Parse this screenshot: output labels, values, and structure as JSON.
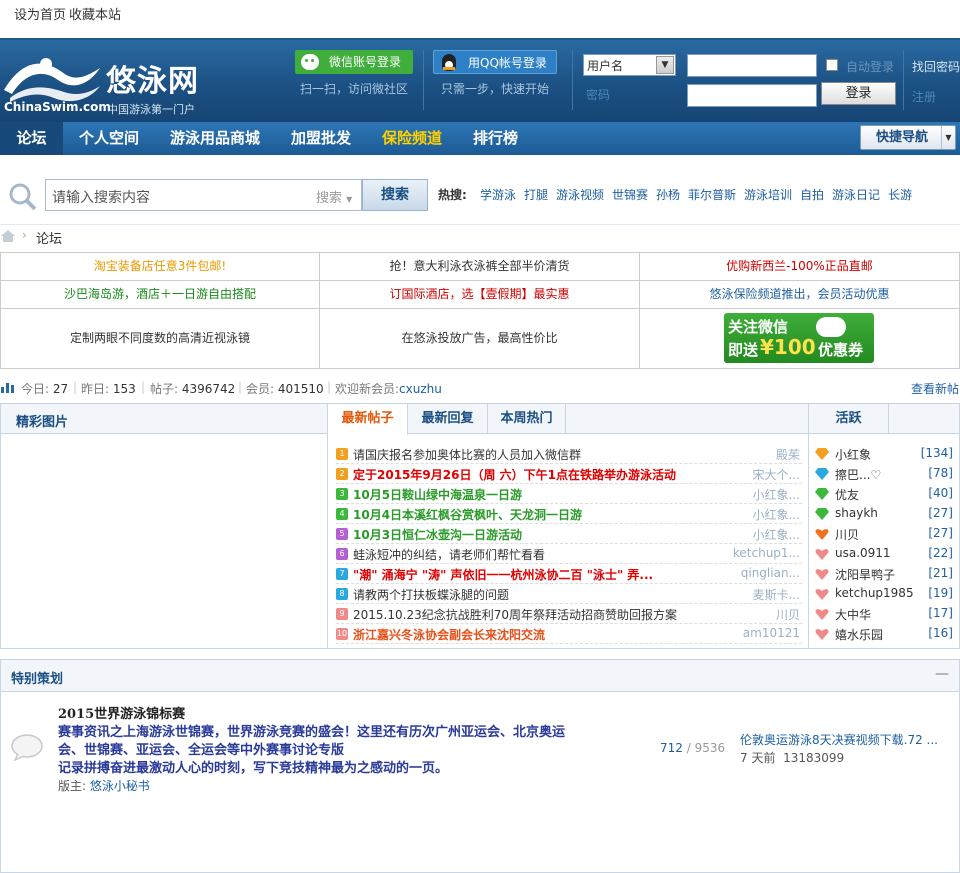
{
  "topbar": {
    "set_home": "设为首页",
    "bookmark": "收藏本站"
  },
  "header": {
    "logo_text": "悠泳网",
    "logo_domain": "ChinaSwim.com",
    "logo_slogan": "中国游泳第一门户",
    "wechat_login": "微信账号登录",
    "wechat_hint": "扫一扫，访问微社区",
    "qq_login": "用QQ帐号登录",
    "qq_hint": "只需一步，快速开始",
    "username_select": "用户名",
    "auto_login": "自动登录",
    "find_password": "找回密码",
    "login_button": "登录",
    "register": "注册",
    "password_label": "密码"
  },
  "nav": {
    "items": [
      "论坛",
      "个人空间",
      "游泳用品商城",
      "加盟批发",
      "保险频道",
      "排行榜"
    ],
    "quick_nav": "快捷导航"
  },
  "search": {
    "placeholder": "请输入搜索内容",
    "type": "搜索",
    "button": "搜索",
    "hot_label": "热搜:",
    "hot_words": [
      "学游泳",
      "打腿",
      "游泳视频",
      "世锦赛",
      "孙杨",
      "菲尔普斯",
      "游泳培训",
      "自拍",
      "游泳日记",
      "长游"
    ]
  },
  "breadcrumb": {
    "current": "论坛"
  },
  "ads": {
    "row1": [
      "淘宝装备店任意3件包邮!",
      "抢！意大利泳衣泳裤全部半价清货",
      "优购新西兰-100%正品直邮"
    ],
    "row2": [
      "沙巴海岛游，酒店＋一日游自由搭配",
      "订国际酒店，选【壹假期】最实惠",
      "悠泳保险频道推出，会员活动优惠"
    ],
    "row3": [
      "定制两眼不同度数的高清近视泳镜",
      "在悠泳投放广告，最高性价比"
    ],
    "banner_line1": "关注微信",
    "banner_line2": "即送",
    "banner_amount": "¥100",
    "banner_line3": "优惠券"
  },
  "stats": {
    "today_label": "今日:",
    "today": "27",
    "yesterday_label": "昨日:",
    "yesterday": "153",
    "posts_label": "帖子:",
    "posts": "4396742",
    "members_label": "会员:",
    "members": "401510",
    "welcome_label": "欢迎新会员:",
    "new_member": "cxuzhu",
    "view_new": "查看新帖"
  },
  "left_panel": {
    "title": "精彩图片"
  },
  "center_panel": {
    "tabs": [
      "最新帖子",
      "最新回复",
      "本周热门"
    ],
    "posts": [
      {
        "title": "请国庆报名参加奥体比赛的人员加入微信群",
        "user": "殿茱",
        "color": "#333333",
        "bold": false
      },
      {
        "title": "定于2015年9月26日（周 六）下午1点在铁路举办游泳活动",
        "user": "宋大个...",
        "color": "#e00000",
        "bold": true
      },
      {
        "title": "10月5日鞍山绿中海温泉一日游",
        "user": "小红象...",
        "color": "#2a9a2a",
        "bold": true
      },
      {
        "title": "10月4日本溪红枫谷赏枫叶、天龙洞一日游",
        "user": "小红象...",
        "color": "#2a9a2a",
        "bold": true
      },
      {
        "title": "10月3日恒仁冰壶沟一日游活动",
        "user": "小红象...",
        "color": "#2a9a2a",
        "bold": true
      },
      {
        "title": "蛙泳短冲的纠结，请老师们帮忙看看",
        "user": "ketchup1...",
        "color": "#333333",
        "bold": false
      },
      {
        "title": "\"潮\" 涌海宁 \"涛\" 声依旧一一杭州泳协二百 \"泳士\" 弄...",
        "user": "qinglian...",
        "color": "#e00000",
        "bold": true
      },
      {
        "title": "请教两个打扶板蝶泳腿的问题",
        "user": "麦斯卡...",
        "color": "#333333",
        "bold": false
      },
      {
        "title": "2015.10.23纪念抗战胜利70周年祭拜活动招商赞助回报方案",
        "user": "川贝",
        "color": "#333333",
        "bold": false
      },
      {
        "title": "浙江嘉兴冬泳协会副会长来沈阳交流",
        "user": "am10121",
        "color": "#e8501a",
        "bold": true
      }
    ]
  },
  "right_panel": {
    "title": "活跃",
    "users": [
      {
        "name": "小红象",
        "count": "[134]",
        "icon": "gold-diamond-icon",
        "color": "#f2a020"
      },
      {
        "name": "擦巴...♡",
        "count": "[78]",
        "icon": "blue-diamond-icon",
        "color": "#2aa8e0"
      },
      {
        "name": "优友",
        "count": "[40]",
        "icon": "green-diamond-icon",
        "color": "#3cb83c"
      },
      {
        "name": "shaykh",
        "count": "[27]",
        "icon": "green-diamond-icon",
        "color": "#3cb83c"
      },
      {
        "name": "川贝",
        "count": "[27]",
        "icon": "orange-heart-icon",
        "color": "#f07020"
      },
      {
        "name": "usa.0911",
        "count": "[22]",
        "icon": "pink-heart-icon",
        "color": "#f08a8a"
      },
      {
        "name": "沈阳旱鸭子",
        "count": "[21]",
        "icon": "pink-heart-icon",
        "color": "#f08a8a"
      },
      {
        "name": "ketchup1985",
        "count": "[19]",
        "icon": "pink-heart-icon",
        "color": "#f08a8a"
      },
      {
        "name": "大中华",
        "count": "[17]",
        "icon": "pink-heart-icon",
        "color": "#f08a8a"
      },
      {
        "name": "嬉水乐园",
        "count": "[16]",
        "icon": "pink-heart-icon",
        "color": "#f08a8a"
      }
    ]
  },
  "special": {
    "title": "特别策划",
    "collapse": "—",
    "forum_name": "2015世界游泳锦标赛",
    "desc_line1": "赛事资讯之上海游泳世锦赛，世界游泳竞赛的盛会！这里还有历次广州亚运会、北京奥运",
    "desc_line2": "会、世锦赛、亚运会、全运会等中外赛事讨论专版",
    "desc_line3": "记录拼搏奋进最激动人心的时刻，写下竞技精神最为之感动的一页。",
    "moderator_label": "版主:",
    "moderator": "悠泳小秘书",
    "threads": "712",
    "posts": "9536",
    "last_title": "伦敦奥运游泳8天决赛视频下载.72 ...",
    "last_time": "7 天前",
    "last_user": "13183099"
  }
}
